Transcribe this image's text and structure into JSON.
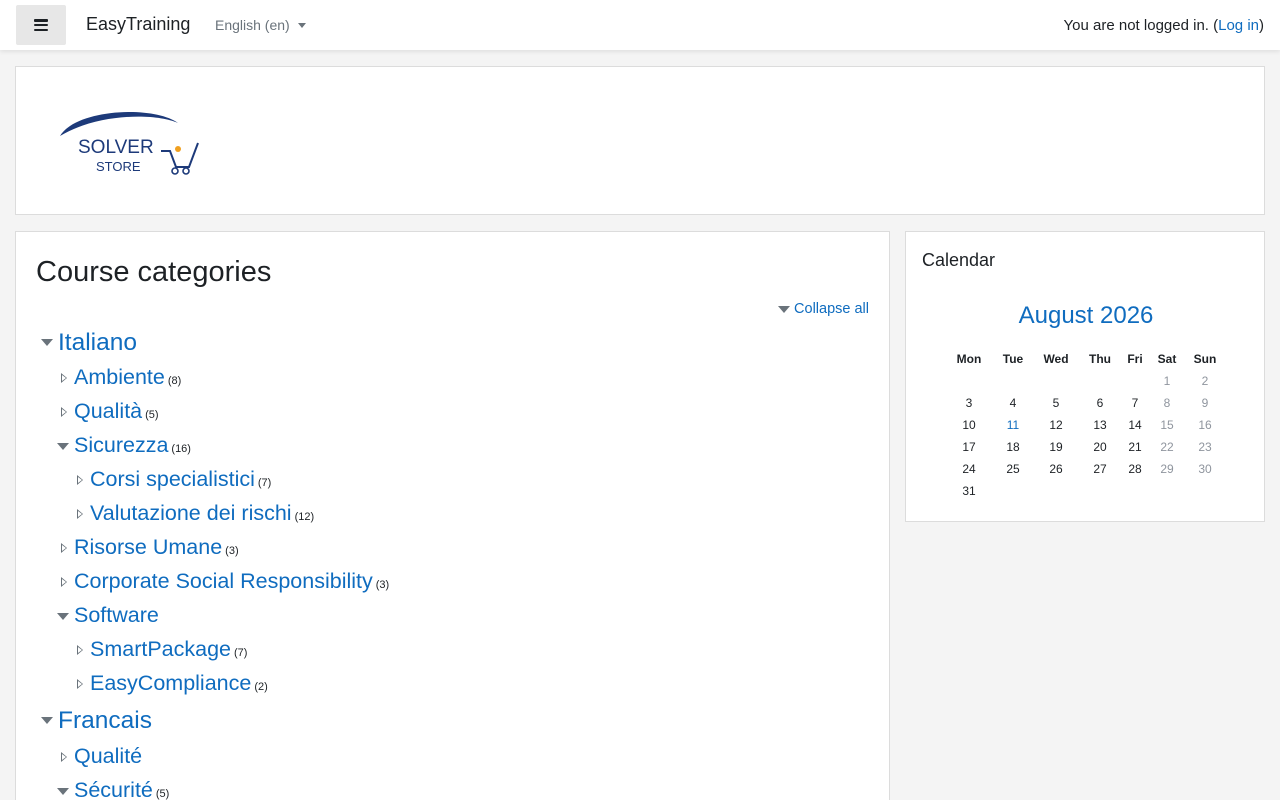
{
  "navbar": {
    "brand": "EasyTraining",
    "language": "English (en)",
    "login_text": "You are not logged in. (",
    "login_link": "Log in",
    "login_close": ")"
  },
  "logo": {
    "line1": "SOLVER",
    "line2": "STORE"
  },
  "main": {
    "title": "Course categories",
    "collapse_all": "Collapse all",
    "categories": [
      {
        "name": "Italiano",
        "count": "",
        "expanded": true
      },
      {
        "name": "Ambiente",
        "count": "(8)",
        "expanded": false
      },
      {
        "name": "Qualità",
        "count": "(5)",
        "expanded": false
      },
      {
        "name": "Sicurezza",
        "count": "(16)",
        "expanded": true
      },
      {
        "name": "Corsi specialistici",
        "count": "(7)",
        "expanded": false
      },
      {
        "name": "Valutazione dei rischi",
        "count": "(12)",
        "expanded": false
      },
      {
        "name": "Risorse Umane",
        "count": "(3)",
        "expanded": false
      },
      {
        "name": "Corporate Social Responsibility",
        "count": "(3)",
        "expanded": false
      },
      {
        "name": "Software",
        "count": "",
        "expanded": true
      },
      {
        "name": "SmartPackage",
        "count": "(7)",
        "expanded": false
      },
      {
        "name": "EasyCompliance",
        "count": "(2)",
        "expanded": false
      },
      {
        "name": "Francais",
        "count": "",
        "expanded": true
      },
      {
        "name": "Qualité",
        "count": "",
        "expanded": false
      },
      {
        "name": "Sécurité",
        "count": "(5)",
        "expanded": true
      }
    ]
  },
  "calendar": {
    "title": "Calendar",
    "month": "August 2026",
    "weekdays": [
      "Mon",
      "Tue",
      "Wed",
      "Thu",
      "Fri",
      "Sat",
      "Sun"
    ],
    "weeks": [
      [
        "",
        "",
        "",
        "",
        "",
        "1",
        "2"
      ],
      [
        "3",
        "4",
        "5",
        "6",
        "7",
        "8",
        "9"
      ],
      [
        "10",
        "11",
        "12",
        "13",
        "14",
        "15",
        "16"
      ],
      [
        "17",
        "18",
        "19",
        "20",
        "21",
        "22",
        "23"
      ],
      [
        "24",
        "25",
        "26",
        "27",
        "28",
        "29",
        "30"
      ],
      [
        "31",
        "",
        "",
        "",
        "",
        "",
        ""
      ]
    ],
    "today": "11"
  },
  "colors": {
    "link": "#0f6cbf",
    "navy": "#1d3a7a",
    "orange": "#f0a020"
  }
}
